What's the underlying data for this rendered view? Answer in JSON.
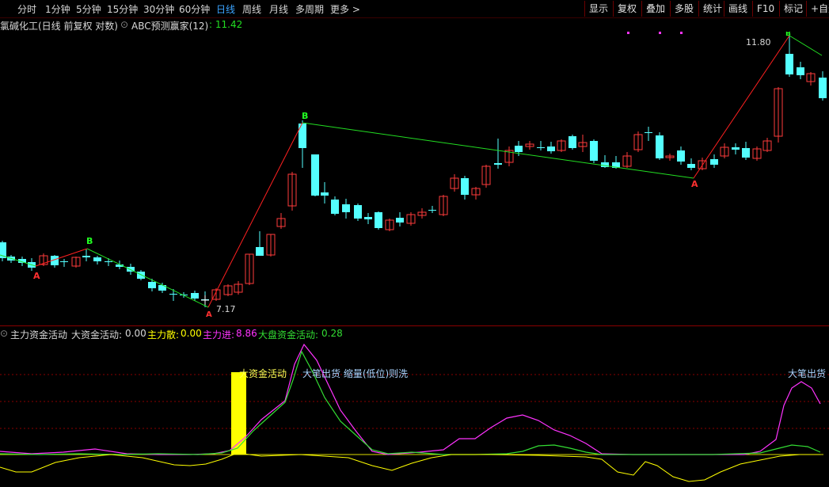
{
  "toolbar": {
    "periods": [
      "分时",
      "1分钟",
      "5分钟",
      "15分钟",
      "30分钟",
      "60分钟",
      "日线",
      "周线",
      "月线",
      "多周期",
      "更多 >"
    ],
    "active": "日线",
    "buttons": [
      "显示",
      "复权",
      "叠加",
      "多股",
      "统计",
      "画线",
      "F10",
      "标记",
      "+自选"
    ]
  },
  "info": {
    "stock": "氯碱化工(日线 前复权 对数)",
    "indicator": "ABC预测赢家(12)",
    "indicator_value": ": 11.42"
  },
  "price_chart": {
    "high_label": "11.80",
    "low_label": "7.17",
    "marker_a": "A",
    "marker_b": "B",
    "colors": {
      "up": "#ff3b3b",
      "down": "#54ffff",
      "rise_line": "#ff2020",
      "fall_line": "#22dd22"
    }
  },
  "sub_indicator": {
    "title": "主力资金活动",
    "big_label": "大资金活动:",
    "big_value": "0.00",
    "scatter_label": "主力散:",
    "scatter_value": "0.00",
    "inflow_label": "主力进:",
    "inflow_value": "8.86",
    "market_label": "大盘资金活动:",
    "market_value": "0.28",
    "annot_big": "大资金活动",
    "annot_sell": "大笔出货 缩量(低位)则洗",
    "annot_sell2": "大笔出货",
    "colors": {
      "magenta": "#ff33ff",
      "green": "#33dd33",
      "yellow": "#ffff00"
    }
  }
}
